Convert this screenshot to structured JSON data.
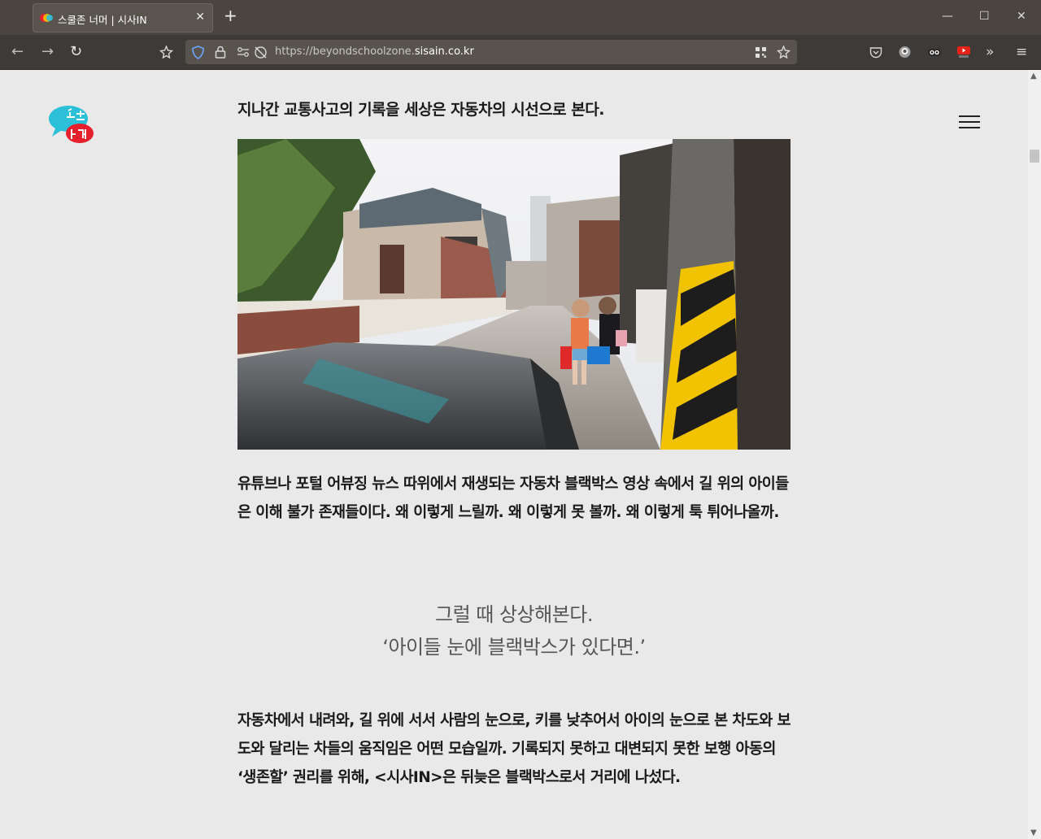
{
  "browser": {
    "tab_title": "스쿨존 너머 | 시사IN",
    "tab_close": "✕",
    "new_tab": "+",
    "url_prefix": "https://beyondschoolzone.",
    "url_host": "sisain.co.kr",
    "window_controls": {
      "minimize": "—",
      "maximize": "☐",
      "close": "✕"
    },
    "nav": {
      "back": "←",
      "forward": "→",
      "reload": "↻"
    }
  },
  "site": {
    "logo_alt": "스쿨존 너머"
  },
  "article": {
    "lead": "지나간 교통사고의 기록을 세상은 자동차의 시선으로 본다.",
    "paragraph1": "유튜브나 포털 어뷰징 뉴스 따위에서 재생되는 자동차 블랙박스 영상 속에서 길 위의 아이들은 이해 불가 존재들이다. 왜 이렇게 느릴까. 왜 이렇게 못 볼까. 왜 이렇게 툭 튀어나올까.",
    "quote_line1": "그럴 때 상상해본다.",
    "quote_line2": "‘아이들 눈에 블랙박스가 있다면.’",
    "paragraph2": "자동차에서 내려와, 길 위에 서서 사람의 눈으로, 키를 낮추어서 아이의 눈으로 본 차도와 보도와 달리는 차들의 움직임은 어떤 모습일까. 기록되지 못하고 대변되지 못한 보행 아동의 ‘생존할’ 권리를 위해, <시사IN>은 뒤늦은 블랙박스로서 거리에 나섰다."
  },
  "colors": {
    "page_bg": "#e9e9e9",
    "tabbar_bg": "#4a4541",
    "toolbar_bg": "#3d3a37",
    "logo_cyan": "#2bbfd8",
    "logo_red": "#e8202e"
  },
  "icons": [
    "back-icon",
    "forward-icon",
    "reload-icon",
    "extension-icon",
    "shield-icon",
    "lock-icon",
    "permissions-icon",
    "tracking-icon",
    "qr-icon",
    "star-icon",
    "pocket-icon",
    "addon-icon",
    "eyes-icon",
    "youtube-icon",
    "overflow-icon",
    "menu-icon",
    "hamburger-icon"
  ]
}
